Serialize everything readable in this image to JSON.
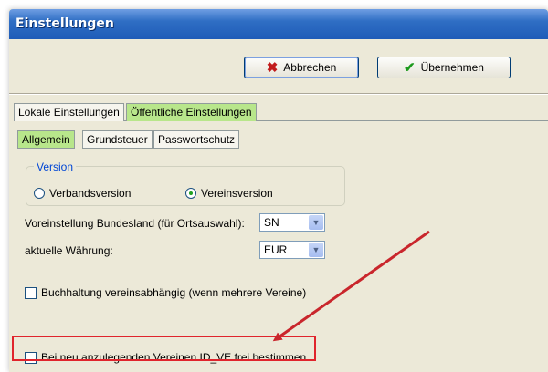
{
  "window": {
    "title": "Einstellungen"
  },
  "toolbar": {
    "cancel_label": "Abbrechen",
    "cancel_icon": "red-x-icon",
    "apply_label": "Übernehmen",
    "apply_icon": "green-check-icon"
  },
  "tabs": {
    "main": [
      {
        "label": "Lokale Einstellungen",
        "active": false
      },
      {
        "label": "Öffentliche Einstellungen",
        "active": true
      }
    ],
    "sub": [
      {
        "label": "Allgemein",
        "active": true
      },
      {
        "label": "Grundsteuer",
        "active": false
      },
      {
        "label": "Passwortschutz",
        "active": false
      }
    ]
  },
  "version_group": {
    "title": "Version",
    "options": [
      {
        "label": "Verbandsversion",
        "selected": false
      },
      {
        "label": "Vereinsversion",
        "selected": true
      }
    ]
  },
  "settings": {
    "bundesland_label": "Voreinstellung Bundesland (für Ortsauswahl):",
    "bundesland_value": "SN",
    "currency_label": "aktuelle Währung:",
    "currency_value": "EUR",
    "accounting_checkbox_label": "Buchhaltung vereinsabhängig (wenn mehrere Vereine)",
    "accounting_checked": false,
    "id_ve_checkbox_label": "Bei neu anzulegenden Vereinen ID_VE frei bestimmen",
    "id_ve_checked": false
  },
  "colors": {
    "active_tab": "#b8e68b",
    "annotation_red": "#e0242c",
    "title_bar": "#2f6ec4"
  }
}
